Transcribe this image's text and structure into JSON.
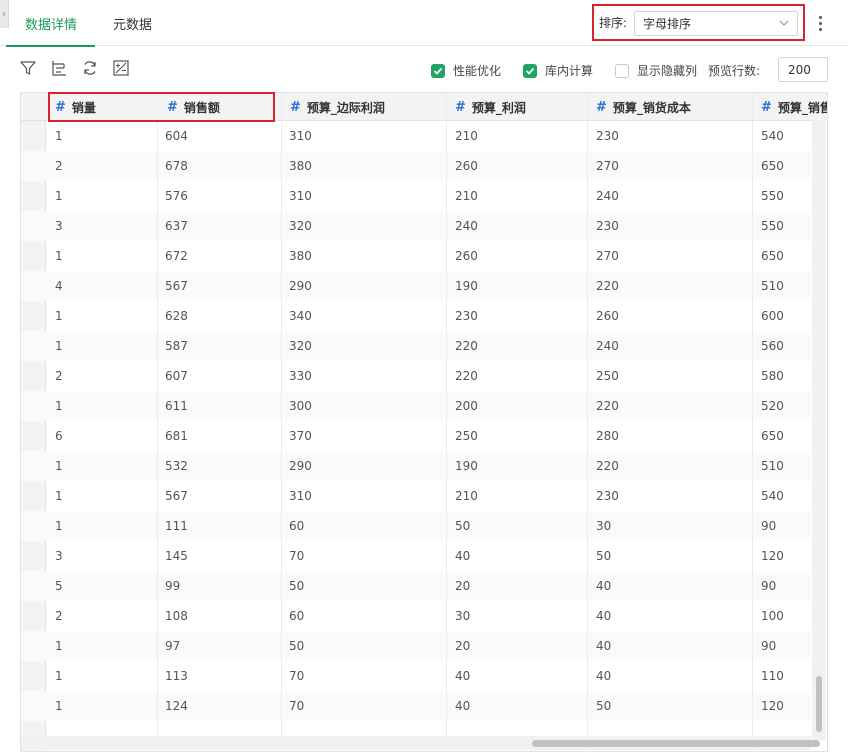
{
  "tabs": [
    {
      "label": "数据详情",
      "active": true
    },
    {
      "label": "元数据",
      "active": false
    }
  ],
  "sort": {
    "label": "排序:",
    "value": "字母排序"
  },
  "toolbar": {
    "icons": [
      "filter-icon",
      "column-settings-icon",
      "refresh-icon",
      "calculated-field-icon"
    ],
    "options": [
      {
        "label": "性能优化",
        "checked": true
      },
      {
        "label": "库内计算",
        "checked": true
      },
      {
        "label": "显示隐藏列",
        "checked": false
      }
    ],
    "preview_rows_label": "预览行数:",
    "preview_rows_value": "200"
  },
  "columns": [
    "销量",
    "销售额",
    "预算_边际利润",
    "预算_利润",
    "预算_销货成本",
    "预算_销售"
  ],
  "rows": [
    [
      "1",
      "604",
      "310",
      "210",
      "230",
      "540"
    ],
    [
      "2",
      "678",
      "380",
      "260",
      "270",
      "650"
    ],
    [
      "1",
      "576",
      "310",
      "210",
      "240",
      "550"
    ],
    [
      "3",
      "637",
      "320",
      "240",
      "230",
      "550"
    ],
    [
      "1",
      "672",
      "380",
      "260",
      "270",
      "650"
    ],
    [
      "4",
      "567",
      "290",
      "190",
      "220",
      "510"
    ],
    [
      "1",
      "628",
      "340",
      "230",
      "260",
      "600"
    ],
    [
      "1",
      "587",
      "320",
      "220",
      "240",
      "560"
    ],
    [
      "2",
      "607",
      "330",
      "220",
      "250",
      "580"
    ],
    [
      "1",
      "611",
      "300",
      "200",
      "220",
      "520"
    ],
    [
      "6",
      "681",
      "370",
      "250",
      "280",
      "650"
    ],
    [
      "1",
      "532",
      "290",
      "190",
      "220",
      "510"
    ],
    [
      "1",
      "567",
      "310",
      "210",
      "230",
      "540"
    ],
    [
      "1",
      "111",
      "60",
      "50",
      "30",
      "90"
    ],
    [
      "3",
      "145",
      "70",
      "40",
      "50",
      "120"
    ],
    [
      "5",
      "99",
      "50",
      "20",
      "40",
      "90"
    ],
    [
      "2",
      "108",
      "60",
      "30",
      "40",
      "100"
    ],
    [
      "1",
      "97",
      "50",
      "20",
      "40",
      "90"
    ],
    [
      "1",
      "113",
      "70",
      "40",
      "40",
      "110"
    ],
    [
      "1",
      "124",
      "70",
      "40",
      "50",
      "120"
    ]
  ],
  "colors": {
    "accent": "#1a9b5c",
    "highlight": "#d9232d",
    "type_icon": "#2a6fd6"
  }
}
